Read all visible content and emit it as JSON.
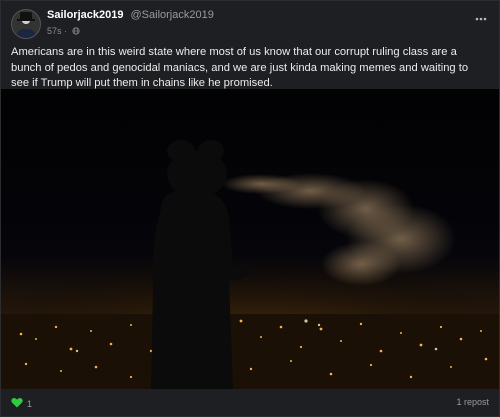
{
  "post": {
    "display_name": "Sailorjack2019",
    "handle": "@Sailorjack2019",
    "timestamp": "57s",
    "separator": "·",
    "visibility_icon": "globe-icon",
    "menu_icon": "more-horizontal-icon",
    "text": "Americans are in this weird state where most of us know that our corrupt ruling class are a bunch of pedos and genocidal maniacs, and we are just kinda making memes and waiting to see if Trump will put them in chains like he promised.",
    "image_icon": "pepe-smoking-cityscape-image",
    "like_icon": "green-heart-icon",
    "like_count": "1",
    "repost_count": "1 repost"
  },
  "colors": {
    "background": "#1e1f22",
    "heart": "#2ecc40",
    "text": "#ececec",
    "muted": "#9a9ba0"
  }
}
